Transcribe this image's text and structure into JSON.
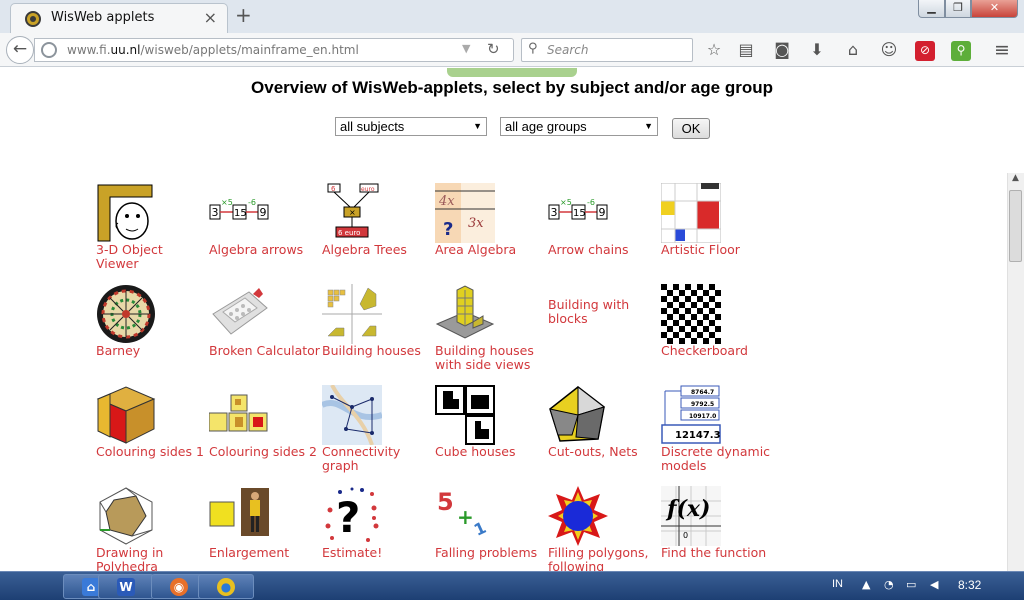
{
  "browser": {
    "tab_title": "WisWeb applets",
    "url_prefix": "www.fi.",
    "url_host": "uu.nl",
    "url_path": "/wisweb/applets/mainframe_en.html",
    "search_placeholder": "Search"
  },
  "page": {
    "title": "Overview of WisWeb-applets, select by subject and/or age group",
    "subject_select": "all subjects",
    "age_select": "all age groups",
    "ok_label": "OK"
  },
  "applets": [
    {
      "label": "3-D Object Viewer",
      "icon": "face-in-frame"
    },
    {
      "label": "Algebra arrows",
      "icon": "arrow-chain"
    },
    {
      "label": "Algebra Trees",
      "icon": "expression-tree"
    },
    {
      "label": "Area Algebra",
      "icon": "area-rectangle"
    },
    {
      "label": "Arrow chains",
      "icon": "arrow-chain"
    },
    {
      "label": "Artistic Floor",
      "icon": "mondrian-grid"
    },
    {
      "label": "Barney",
      "icon": "dartboard"
    },
    {
      "label": "Broken Calculator",
      "icon": "calculator"
    },
    {
      "label": "Building houses",
      "icon": "block-views"
    },
    {
      "label": "Building houses with side views",
      "icon": "block-tower"
    },
    {
      "label": "Building with blocks",
      "icon": ""
    },
    {
      "label": "Checkerboard",
      "icon": "checkerboard"
    },
    {
      "label": "Colouring sides 1",
      "icon": "coloured-prism"
    },
    {
      "label": "Colouring sides 2",
      "icon": "coloured-cubes"
    },
    {
      "label": "Connectivity graph",
      "icon": "map-graph"
    },
    {
      "label": "Cube houses",
      "icon": "cube-shapes"
    },
    {
      "label": "Cut-outs, Nets",
      "icon": "polyhedron"
    },
    {
      "label": "Discrete dynamic models",
      "icon": "number-table"
    },
    {
      "label": "Drawing in Polyhedra",
      "icon": "wire-polyhedron"
    },
    {
      "label": "Enlargement",
      "icon": "person-scale"
    },
    {
      "label": "Estimate!",
      "icon": "question-dots"
    },
    {
      "label": "Falling problems",
      "icon": "falling-numbers"
    },
    {
      "label": "Filling polygons, following",
      "icon": "star-polygon"
    },
    {
      "label": "Find the function",
      "icon": "fx-graph"
    }
  ],
  "taskbar": {
    "lang": "IN",
    "clock": "8:32"
  }
}
